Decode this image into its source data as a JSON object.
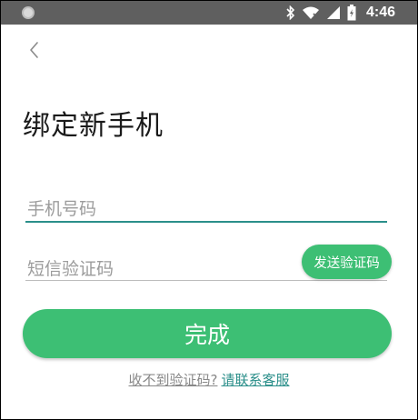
{
  "status_bar": {
    "time": "4:46",
    "background": "#5f5f5f",
    "icons": [
      "circle-indicator-icon",
      "bluetooth-icon",
      "wifi-icon",
      "cell-signal-icon",
      "battery-icon"
    ]
  },
  "nav": {
    "back_icon": "chevron-left-icon"
  },
  "page": {
    "title": "绑定新手机"
  },
  "form": {
    "phone_placeholder": "手机号码",
    "code_placeholder": "短信验证码",
    "send_code_label": "发送验证码",
    "submit_label": "完成"
  },
  "help": {
    "text": "收不到验证码?",
    "link_text": "请联系客服"
  },
  "colors": {
    "accent_green": "#3dbf74",
    "focus_teal": "#2b8f8a",
    "placeholder_gray": "#9c9c9c"
  }
}
